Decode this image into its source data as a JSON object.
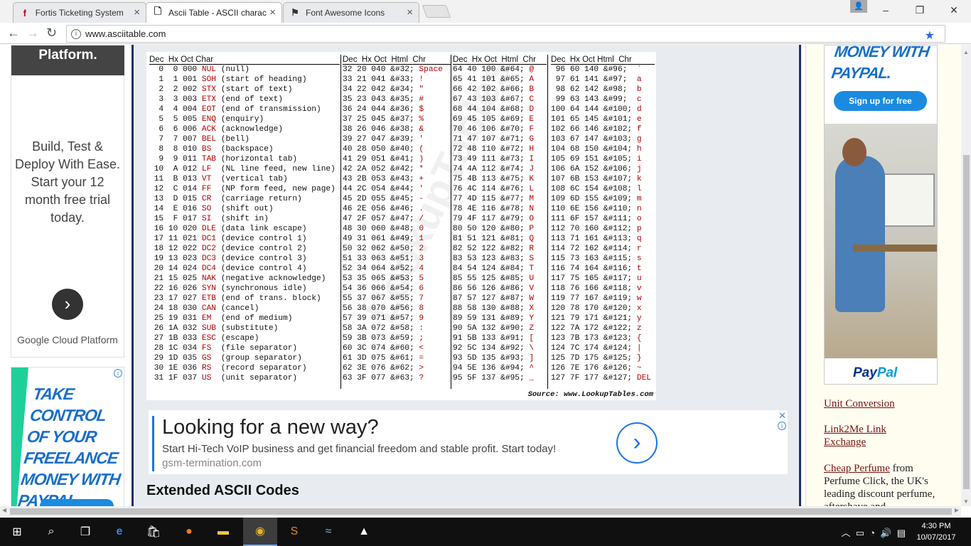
{
  "browser": {
    "tabs": [
      {
        "label": "Fortis Ticketing System",
        "favicon": "f"
      },
      {
        "label": "Ascii Table - ASCII charac",
        "favicon": "doc"
      },
      {
        "label": "Font Awesome Icons",
        "favicon": "flag"
      }
    ],
    "url": "www.asciitable.com"
  },
  "left_ad": {
    "header": "Platform.",
    "body": "Build, Test & Deploy With Ease. Start your 12 month free trial today.",
    "brand": "Google Cloud Platform",
    "paypal_text": "TAKE CONTROL OF YOUR FREELANCE MONEY WITH PAYPAL."
  },
  "ascii": {
    "headers": [
      "Dec  Hx Oct Char",
      "Dec  Hx Oct  Html  Chr",
      "Dec  Hx Oct  Html  Chr",
      "Dec  Hx Oct Html  Chr"
    ],
    "control": [
      [
        "  0  0 000 ",
        "NUL",
        " (null)"
      ],
      [
        "  1  1 001 ",
        "SOH",
        " (start of heading)"
      ],
      [
        "  2  2 002 ",
        "STX",
        " (start of text)"
      ],
      [
        "  3  3 003 ",
        "ETX",
        " (end of text)"
      ],
      [
        "  4  4 004 ",
        "EOT",
        " (end of transmission)"
      ],
      [
        "  5  5 005 ",
        "ENQ",
        " (enquiry)"
      ],
      [
        "  6  6 006 ",
        "ACK",
        " (acknowledge)"
      ],
      [
        "  7  7 007 ",
        "BEL",
        " (bell)"
      ],
      [
        "  8  8 010 ",
        "BS ",
        " (backspace)"
      ],
      [
        "  9  9 011 ",
        "TAB",
        " (horizontal tab)"
      ],
      [
        " 10  A 012 ",
        "LF ",
        " (NL line feed, new line)"
      ],
      [
        " 11  B 013 ",
        "VT ",
        " (vertical tab)"
      ],
      [
        " 12  C 014 ",
        "FF ",
        " (NP form feed, new page)"
      ],
      [
        " 13  D 015 ",
        "CR ",
        " (carriage return)"
      ],
      [
        " 14  E 016 ",
        "SO ",
        " (shift out)"
      ],
      [
        " 15  F 017 ",
        "SI ",
        " (shift in)"
      ],
      [
        " 16 10 020 ",
        "DLE",
        " (data link escape)"
      ],
      [
        " 17 11 021 ",
        "DC1",
        " (device control 1)"
      ],
      [
        " 18 12 022 ",
        "DC2",
        " (device control 2)"
      ],
      [
        " 19 13 023 ",
        "DC3",
        " (device control 3)"
      ],
      [
        " 20 14 024 ",
        "DC4",
        " (device control 4)"
      ],
      [
        " 21 15 025 ",
        "NAK",
        " (negative acknowledge)"
      ],
      [
        " 22 16 026 ",
        "SYN",
        " (synchronous idle)"
      ],
      [
        " 23 17 027 ",
        "ETB",
        " (end of trans. block)"
      ],
      [
        " 24 18 030 ",
        "CAN",
        " (cancel)"
      ],
      [
        " 25 19 031 ",
        "EM ",
        " (end of medium)"
      ],
      [
        " 26 1A 032 ",
        "SUB",
        " (substitute)"
      ],
      [
        " 27 1B 033 ",
        "ESC",
        " (escape)"
      ],
      [
        " 28 1C 034 ",
        "FS ",
        " (file separator)"
      ],
      [
        " 29 1D 035 ",
        "GS ",
        " (group separator)"
      ],
      [
        " 30 1E 036 ",
        "RS ",
        " (record separator)"
      ],
      [
        " 31 1F 037 ",
        "US ",
        " (unit separator)"
      ]
    ],
    "col2": [
      [
        "32 20 040 &#32; ",
        "Space"
      ],
      [
        "33 21 041 &#33; ",
        "!"
      ],
      [
        "34 22 042 &#34; ",
        "\""
      ],
      [
        "35 23 043 &#35; ",
        "#"
      ],
      [
        "36 24 044 &#36; ",
        "$"
      ],
      [
        "37 25 045 &#37; ",
        "%"
      ],
      [
        "38 26 046 &#38; ",
        "&"
      ],
      [
        "39 27 047 &#39; ",
        "'"
      ],
      [
        "40 28 050 &#40; ",
        "("
      ],
      [
        "41 29 051 &#41; ",
        ")"
      ],
      [
        "42 2A 052 &#42; ",
        "*"
      ],
      [
        "43 2B 053 &#43; ",
        "+"
      ],
      [
        "44 2C 054 &#44; ",
        "'"
      ],
      [
        "45 2D 055 &#45; ",
        "-"
      ],
      [
        "46 2E 056 &#46; ",
        "."
      ],
      [
        "47 2F 057 &#47; ",
        "/"
      ],
      [
        "48 30 060 &#48; ",
        "0"
      ],
      [
        "49 31 061 &#49; ",
        "1"
      ],
      [
        "50 32 062 &#50; ",
        "2"
      ],
      [
        "51 33 063 &#51; ",
        "3"
      ],
      [
        "52 34 064 &#52; ",
        "4"
      ],
      [
        "53 35 065 &#53; ",
        "5"
      ],
      [
        "54 36 066 &#54; ",
        "6"
      ],
      [
        "55 37 067 &#55; ",
        "7"
      ],
      [
        "56 38 070 &#56; ",
        "8"
      ],
      [
        "57 39 071 &#57; ",
        "9"
      ],
      [
        "58 3A 072 &#58; ",
        ":"
      ],
      [
        "59 3B 073 &#59; ",
        ";"
      ],
      [
        "60 3C 074 &#60; ",
        "<"
      ],
      [
        "61 3D 075 &#61; ",
        "="
      ],
      [
        "62 3E 076 &#62; ",
        ">"
      ],
      [
        "63 3F 077 &#63; ",
        "?"
      ]
    ],
    "col3": [
      [
        "64 40 100 &#64; ",
        "@"
      ],
      [
        "65 41 101 &#65; ",
        "A"
      ],
      [
        "66 42 102 &#66; ",
        "B"
      ],
      [
        "67 43 103 &#67; ",
        "C"
      ],
      [
        "68 44 104 &#68; ",
        "D"
      ],
      [
        "69 45 105 &#69; ",
        "E"
      ],
      [
        "70 46 106 &#70; ",
        "F"
      ],
      [
        "71 47 107 &#71; ",
        "G"
      ],
      [
        "72 48 110 &#72; ",
        "H"
      ],
      [
        "73 49 111 &#73; ",
        "I"
      ],
      [
        "74 4A 112 &#74; ",
        "J"
      ],
      [
        "75 4B 113 &#75; ",
        "K"
      ],
      [
        "76 4C 114 &#76; ",
        "L"
      ],
      [
        "77 4D 115 &#77; ",
        "M"
      ],
      [
        "78 4E 116 &#78; ",
        "N"
      ],
      [
        "79 4F 117 &#79; ",
        "O"
      ],
      [
        "80 50 120 &#80; ",
        "P"
      ],
      [
        "81 51 121 &#81; ",
        "Q"
      ],
      [
        "82 52 122 &#82; ",
        "R"
      ],
      [
        "83 53 123 &#83; ",
        "S"
      ],
      [
        "84 54 124 &#84; ",
        "T"
      ],
      [
        "85 55 125 &#85; ",
        "U"
      ],
      [
        "86 56 126 &#86; ",
        "V"
      ],
      [
        "87 57 127 &#87; ",
        "W"
      ],
      [
        "88 58 130 &#88; ",
        "X"
      ],
      [
        "89 59 131 &#89; ",
        "Y"
      ],
      [
        "90 5A 132 &#90; ",
        "Z"
      ],
      [
        "91 5B 133 &#91; ",
        "["
      ],
      [
        "92 5C 134 &#92; ",
        "\\"
      ],
      [
        "93 5D 135 &#93; ",
        "]"
      ],
      [
        "94 5E 136 &#94; ",
        "^"
      ],
      [
        "95 5F 137 &#95; ",
        "_"
      ]
    ],
    "col4": [
      [
        " 96 60 140 &#96;  ",
        "`"
      ],
      [
        " 97 61 141 &#97;  ",
        "a"
      ],
      [
        " 98 62 142 &#98;  ",
        "b"
      ],
      [
        " 99 63 143 &#99;  ",
        "c"
      ],
      [
        "100 64 144 &#100; ",
        "d"
      ],
      [
        "101 65 145 &#101; ",
        "e"
      ],
      [
        "102 66 146 &#102; ",
        "f"
      ],
      [
        "103 67 147 &#103; ",
        "g"
      ],
      [
        "104 68 150 &#104; ",
        "h"
      ],
      [
        "105 69 151 &#105; ",
        "i"
      ],
      [
        "106 6A 152 &#106; ",
        "j"
      ],
      [
        "107 6B 153 &#107; ",
        "k"
      ],
      [
        "108 6C 154 &#108; ",
        "l"
      ],
      [
        "109 6D 155 &#109; ",
        "m"
      ],
      [
        "110 6E 156 &#110; ",
        "n"
      ],
      [
        "111 6F 157 &#111; ",
        "o"
      ],
      [
        "112 70 160 &#112; ",
        "p"
      ],
      [
        "113 71 161 &#113; ",
        "q"
      ],
      [
        "114 72 162 &#114; ",
        "r"
      ],
      [
        "115 73 163 &#115; ",
        "s"
      ],
      [
        "116 74 164 &#116; ",
        "t"
      ],
      [
        "117 75 165 &#117; ",
        "u"
      ],
      [
        "118 76 166 &#118; ",
        "v"
      ],
      [
        "119 77 167 &#119; ",
        "w"
      ],
      [
        "120 78 170 &#120; ",
        "x"
      ],
      [
        "121 79 171 &#121; ",
        "y"
      ],
      [
        "122 7A 172 &#122; ",
        "z"
      ],
      [
        "123 7B 173 &#123; ",
        "{"
      ],
      [
        "124 7C 174 &#124; ",
        "|"
      ],
      [
        "125 7D 175 &#125; ",
        "}"
      ],
      [
        "126 7E 176 &#126; ",
        "~"
      ],
      [
        "127 7F 177 &#127; ",
        "DEL"
      ]
    ],
    "source": "Source:  www.LookupTables.com"
  },
  "center_ad": {
    "headline": "Looking for a new way?",
    "sub": "Start Hi-Tech VoIP business and get financial freedom and stable profit. Start today!",
    "url": "gsm-termination.com"
  },
  "section_title": "Extended ASCII Codes",
  "right_ad": {
    "text": "MONEY WITH PAYPAL.",
    "button": "Sign up for free",
    "logo_a": "Pay",
    "logo_b": "Pal"
  },
  "right_links": {
    "unit_conversion": "Unit Conversion",
    "link2me": "Link2Me Link Exchange",
    "perfume_link": "Cheap Perfume",
    "perfume_text": " from Perfume Click, the UK's leading discount perfume, aftershave and"
  },
  "taskbar": {
    "time": "4:30 PM",
    "date": "10/07/2017"
  },
  "colors": {
    "accent": "#1a73e8",
    "link": "#7a1010",
    "control_red": "#b30000"
  }
}
